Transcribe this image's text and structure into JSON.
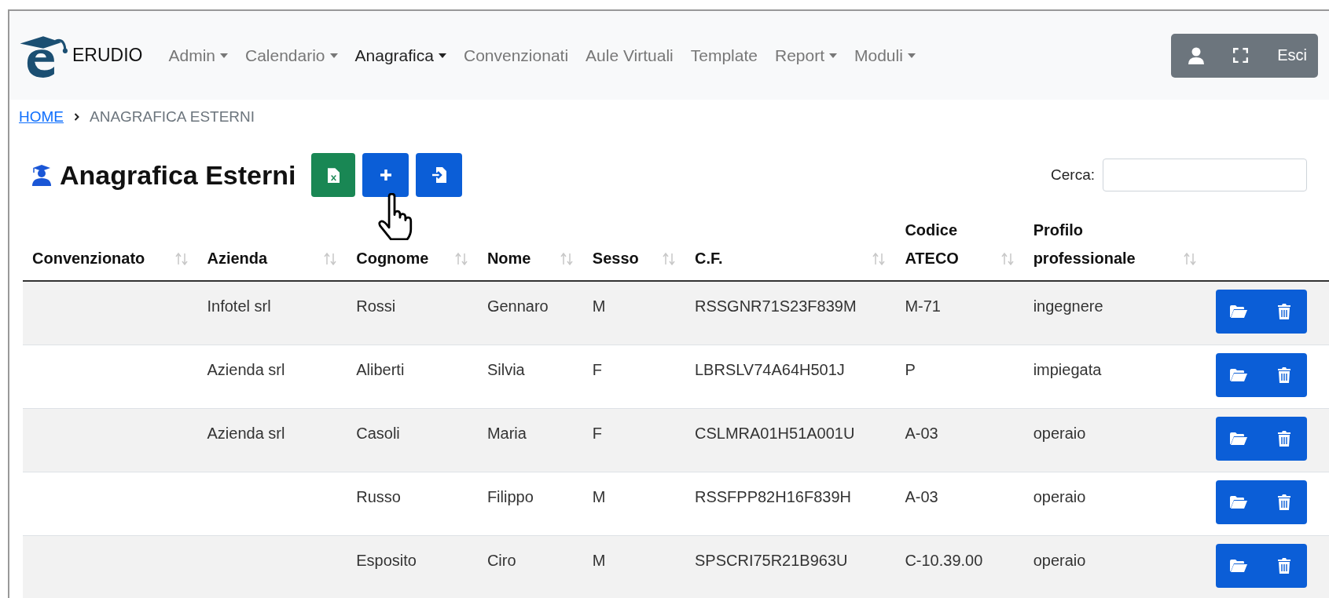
{
  "brand": {
    "name": "ERUDIO"
  },
  "nav": [
    {
      "label": "Admin",
      "dropdown": true,
      "selected": false
    },
    {
      "label": "Calendario",
      "dropdown": true,
      "selected": false
    },
    {
      "label": "Anagrafica",
      "dropdown": true,
      "selected": true
    },
    {
      "label": "Convenzionati",
      "dropdown": false,
      "selected": false
    },
    {
      "label": "Aule Virtuali",
      "dropdown": false,
      "selected": false
    },
    {
      "label": "Template",
      "dropdown": false,
      "selected": false
    },
    {
      "label": "Report",
      "dropdown": true,
      "selected": false
    },
    {
      "label": "Moduli",
      "dropdown": true,
      "selected": false
    }
  ],
  "user_menu": {
    "logout": "Esci"
  },
  "breadcrumb": {
    "home": "HOME",
    "current": "ANAGRAFICA ESTERNI"
  },
  "page": {
    "title": "Anagrafica Esterni"
  },
  "search": {
    "label": "Cerca:"
  },
  "table": {
    "columns": [
      {
        "lines": [
          "Convenzionato"
        ]
      },
      {
        "lines": [
          "Azienda"
        ]
      },
      {
        "lines": [
          "Cognome"
        ]
      },
      {
        "lines": [
          "Nome"
        ]
      },
      {
        "lines": [
          "Sesso"
        ]
      },
      {
        "lines": [
          "C.F."
        ]
      },
      {
        "lines": [
          "Codice",
          "ATECO"
        ]
      },
      {
        "lines": [
          "Profilo",
          "professionale"
        ]
      }
    ],
    "rows": [
      {
        "cells": [
          "",
          "Infotel srl",
          "Rossi",
          "Gennaro",
          "M",
          "RSSGNR71S23F839M",
          "M-71",
          "ingegnere"
        ]
      },
      {
        "cells": [
          "",
          "Azienda srl",
          "Aliberti",
          "Silvia",
          "F",
          "LBRSLV74A64H501J",
          "P",
          "impiegata"
        ]
      },
      {
        "cells": [
          "",
          "Azienda srl",
          "Casoli",
          "Maria",
          "F",
          "CSLMRA01H51A001U",
          "A-03",
          "operaio"
        ]
      },
      {
        "cells": [
          "",
          "",
          "Russo",
          "Filippo",
          "M",
          "RSSFPP82H16F839H",
          "A-03",
          "operaio"
        ]
      },
      {
        "cells": [
          "",
          "",
          "Esposito",
          "Ciro",
          "M",
          "SPSCRI75R21B963U",
          "C-10.39.00",
          "operaio"
        ]
      }
    ]
  }
}
